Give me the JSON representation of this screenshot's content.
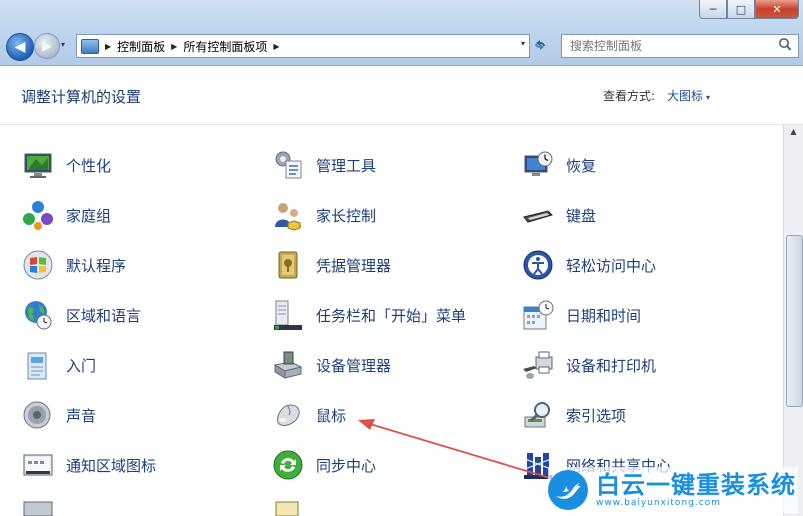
{
  "window": {
    "controls": {
      "minimize": "─",
      "maximize": "□",
      "close": "✕"
    }
  },
  "nav": {
    "back": "◀",
    "forward": "▶",
    "history_drop": "▾"
  },
  "address_bar": {
    "breadcrumbs": [
      "控制面板",
      "所有控制面板项"
    ],
    "separator": "▶",
    "dropdown": "▾"
  },
  "search": {
    "placeholder": "搜索控制面板"
  },
  "header": {
    "title": "调整计算机的设置",
    "view_label": "查看方式:",
    "view_value": "大图标",
    "view_drop": "▾"
  },
  "items": [
    {
      "label": "个性化",
      "icon": "personalization-icon"
    },
    {
      "label": "管理工具",
      "icon": "admin-tools-icon"
    },
    {
      "label": "恢复",
      "icon": "recovery-icon"
    },
    {
      "label": "家庭组",
      "icon": "homegroup-icon"
    },
    {
      "label": "家长控制",
      "icon": "parental-controls-icon"
    },
    {
      "label": "键盘",
      "icon": "keyboard-icon"
    },
    {
      "label": "默认程序",
      "icon": "default-programs-icon"
    },
    {
      "label": "凭据管理器",
      "icon": "credential-manager-icon"
    },
    {
      "label": "轻松访问中心",
      "icon": "ease-of-access-icon"
    },
    {
      "label": "区域和语言",
      "icon": "region-language-icon"
    },
    {
      "label": "任务栏和「开始」菜单",
      "icon": "taskbar-start-icon"
    },
    {
      "label": "日期和时间",
      "icon": "date-time-icon"
    },
    {
      "label": "入门",
      "icon": "getting-started-icon"
    },
    {
      "label": "设备管理器",
      "icon": "device-manager-icon"
    },
    {
      "label": "设备和打印机",
      "icon": "devices-printers-icon"
    },
    {
      "label": "声音",
      "icon": "sound-icon"
    },
    {
      "label": "鼠标",
      "icon": "mouse-icon"
    },
    {
      "label": "索引选项",
      "icon": "indexing-options-icon"
    },
    {
      "label": "通知区域图标",
      "icon": "notification-icons-icon"
    },
    {
      "label": "同步中心",
      "icon": "sync-center-icon"
    },
    {
      "label": "网络和共享中心",
      "icon": "network-sharing-icon"
    }
  ],
  "watermark": {
    "text": "白云一键重装系统",
    "url": "www.baiyunxitong.com"
  },
  "colors": {
    "link": "#1e3f7a",
    "title": "#1e3a6e",
    "arrow": "#e0504a",
    "watermark": "#1a8fe0"
  }
}
